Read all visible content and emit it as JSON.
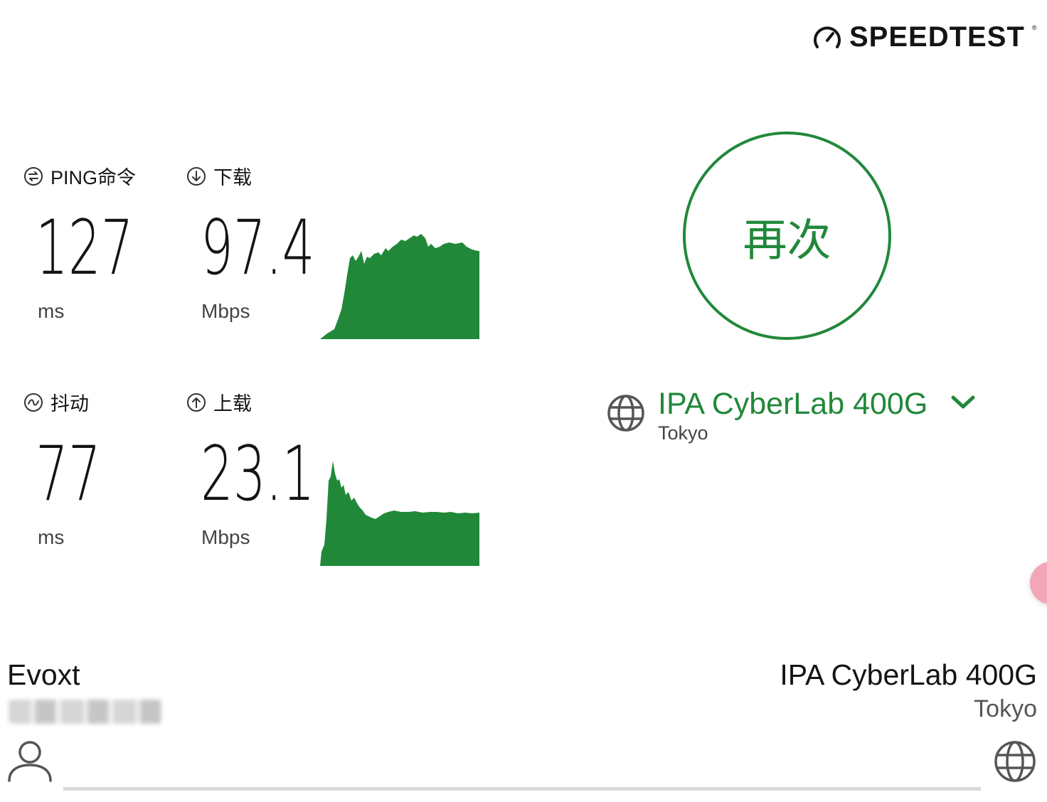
{
  "brand": {
    "logo_text": "SPEEDTEST",
    "trademark": "®",
    "accent": "#21883a"
  },
  "metrics": {
    "ping": {
      "label": "PING命令",
      "value": "127",
      "unit": "ms"
    },
    "download": {
      "label": "下载",
      "value": "97.4",
      "unit": "Mbps"
    },
    "jitter": {
      "label": "抖动",
      "value": "77",
      "unit": "ms"
    },
    "upload": {
      "label": "上载",
      "value": "23.1",
      "unit": "Mbps"
    }
  },
  "actions": {
    "go_again_label": "再次"
  },
  "server": {
    "name": "IPA CyberLab 400G",
    "city": "Tokyo"
  },
  "footer": {
    "isp_name": "Evoxt",
    "host_name": "IPA CyberLab 400G",
    "host_city": "Tokyo"
  },
  "icons": {
    "logo": "speedometer-icon",
    "ping": "ping-icon",
    "download": "download-arrow-icon",
    "jitter": "jitter-wave-icon",
    "upload": "upload-arrow-icon",
    "server": "globe-icon",
    "dropdown": "chevron-down-icon",
    "user": "user-icon",
    "host": "globe-icon"
  }
}
